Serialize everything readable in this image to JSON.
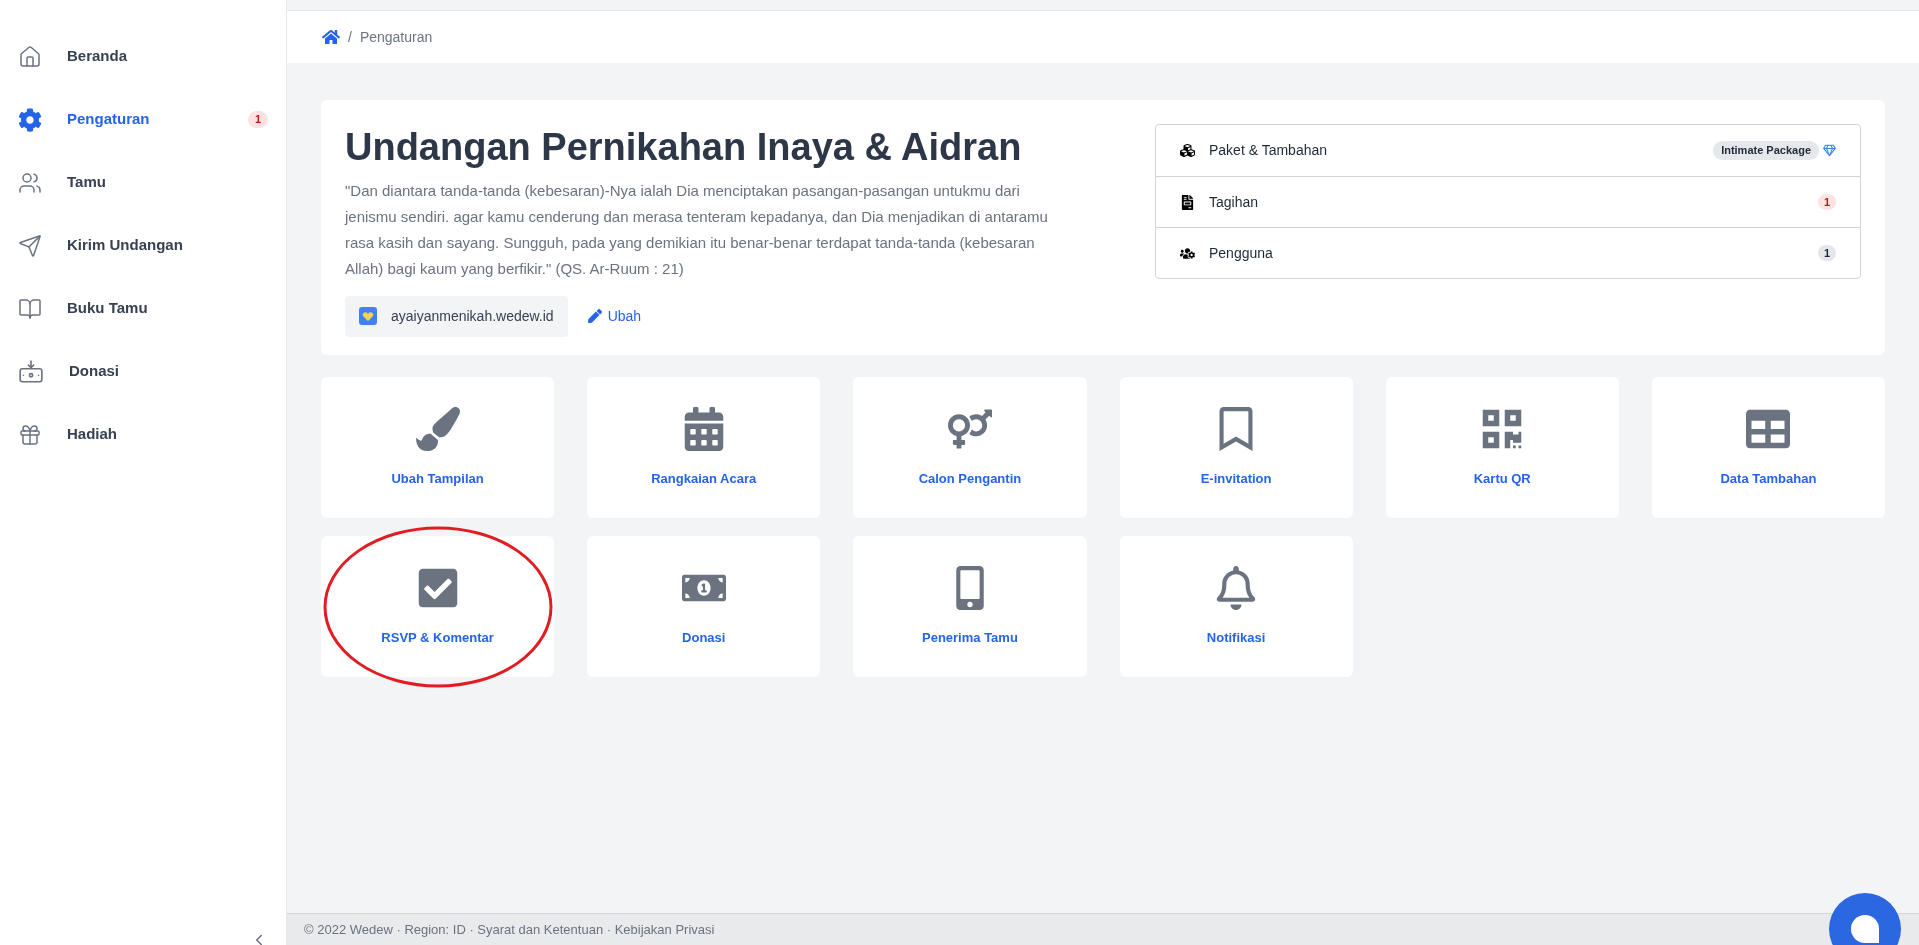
{
  "sidebar": {
    "items": [
      {
        "label": "Beranda",
        "selected": false
      },
      {
        "label": "Pengaturan",
        "selected": true,
        "badge": "1"
      },
      {
        "label": "Tamu",
        "selected": false
      },
      {
        "label": "Kirim Undangan",
        "selected": false
      },
      {
        "label": "Buku Tamu",
        "selected": false
      },
      {
        "label": "Donasi",
        "selected": false
      },
      {
        "label": "Hadiah",
        "selected": false
      }
    ]
  },
  "breadcrumb": {
    "separator": "/",
    "current": "Pengaturan"
  },
  "event": {
    "title": "Undangan Pernikahan Inaya & Aidran",
    "quote": "\"Dan diantara tanda-tanda (kebesaran)-Nya ialah Dia menciptakan pasangan-pasangan untukmu dari jenismu sendiri. agar kamu cenderung dan merasa tenteram kepadanya, dan Dia menjadikan di antaramu rasa kasih dan sayang. Sungguh, pada yang demikian itu benar-benar terdapat tanda-tanda (kebesaran Allah) bagi kaum yang berfikir.\" (QS. Ar-Ruum : 21)",
    "domain": "ayaiyanmenikah.wedew.id",
    "edit_link": "Ubah"
  },
  "account_list": [
    {
      "label": "Paket & Tambahan",
      "kind": "package",
      "badge": "Intimate Package"
    },
    {
      "label": "Tagihan",
      "kind": "alert",
      "badge": "1"
    },
    {
      "label": "Pengguna",
      "kind": "count",
      "badge": "1"
    }
  ],
  "tiles": [
    {
      "label": "Ubah Tampilan",
      "highlighted": false
    },
    {
      "label": "Rangkaian Acara",
      "highlighted": false
    },
    {
      "label": "Calon Pengantin",
      "highlighted": false
    },
    {
      "label": "E-invitation",
      "highlighted": false
    },
    {
      "label": "Kartu QR",
      "highlighted": false
    },
    {
      "label": "Data Tambahan",
      "highlighted": false
    },
    {
      "label": "RSVP & Komentar",
      "highlighted": true
    },
    {
      "label": "Donasi",
      "highlighted": false
    },
    {
      "label": "Penerima Tamu",
      "highlighted": false
    },
    {
      "label": "Notifikasi",
      "highlighted": false
    }
  ],
  "footer": {
    "text": "© 2022 Wedew · Region: ID · Syarat dan Ketentuan · Kebijakan Privasi"
  }
}
